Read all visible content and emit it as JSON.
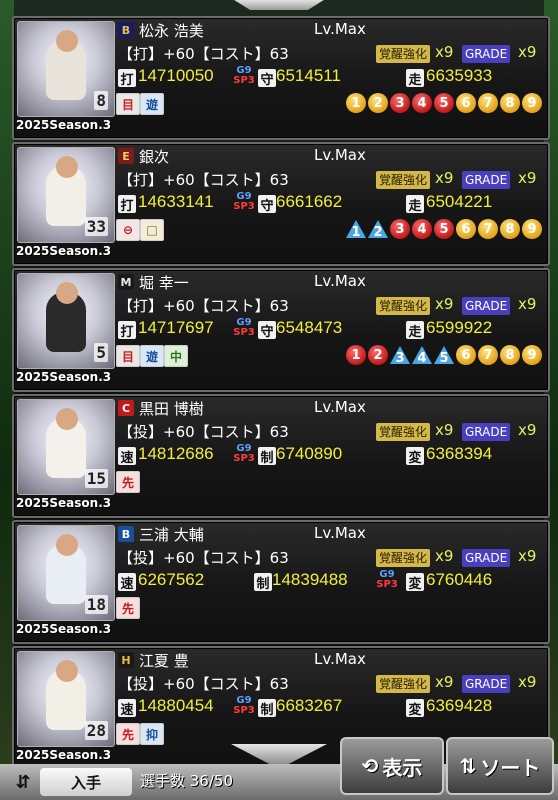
{
  "players": [
    {
      "team_icon": "B",
      "team_color": "#1a1a6a",
      "team_fg": "#e8c23a",
      "name": "松永 浩美",
      "level": "Lv.Max",
      "line2": "【打】+60【コスト】63",
      "awake_label": "覚醒強化",
      "awake_mult": "x9",
      "grade_label": "GRADE",
      "grade_mult": "x9",
      "stats": [
        {
          "label": "打",
          "value": "14710050"
        },
        {
          "label": "守",
          "value": "6514511"
        },
        {
          "label": "走",
          "value": "6635933"
        }
      ],
      "g9": "G9",
      "sp3": "SP3",
      "jersey": "8",
      "uniform_color": "#e8e4dc",
      "season": "2025Season.3",
      "positions": [
        {
          "text": "目",
          "bg": "#e8e8e8",
          "fg": "#d02020"
        },
        {
          "text": "遊",
          "bg": "#d9e6f5",
          "fg": "#1a4fa0"
        }
      ],
      "batting_order": [
        {
          "n": "1",
          "s": "y"
        },
        {
          "n": "2",
          "s": "y"
        },
        {
          "n": "3",
          "s": "r"
        },
        {
          "n": "4",
          "s": "r"
        },
        {
          "n": "5",
          "s": "r"
        },
        {
          "n": "6",
          "s": "y"
        },
        {
          "n": "7",
          "s": "y"
        },
        {
          "n": "8",
          "s": "y"
        },
        {
          "n": "9",
          "s": "y"
        }
      ]
    },
    {
      "team_icon": "E",
      "team_color": "#7a1c1c",
      "team_fg": "#f0d060",
      "name": "銀次",
      "level": "Lv.Max",
      "line2": "【打】+60【コスト】63",
      "awake_label": "覚醒強化",
      "awake_mult": "x9",
      "grade_label": "GRADE",
      "grade_mult": "x9",
      "stats": [
        {
          "label": "打",
          "value": "14633141"
        },
        {
          "label": "守",
          "value": "6661662"
        },
        {
          "label": "走",
          "value": "6504221"
        }
      ],
      "g9": "G9",
      "sp3": "SP3",
      "jersey": "33",
      "uniform_color": "#f2efe8",
      "season": "2025Season.3",
      "positions": [
        {
          "text": "⊖",
          "bg": "#f2e6e6",
          "fg": "#c01a1a"
        },
        {
          "text": "□",
          "bg": "#f2ecd8",
          "fg": "#8a6a10"
        }
      ],
      "batting_order": [
        {
          "n": "1",
          "s": "t"
        },
        {
          "n": "2",
          "s": "t"
        },
        {
          "n": "3",
          "s": "r"
        },
        {
          "n": "4",
          "s": "r"
        },
        {
          "n": "5",
          "s": "r"
        },
        {
          "n": "6",
          "s": "y"
        },
        {
          "n": "7",
          "s": "y"
        },
        {
          "n": "8",
          "s": "y"
        },
        {
          "n": "9",
          "s": "y"
        }
      ]
    },
    {
      "team_icon": "M",
      "team_color": "#1a1a1a",
      "team_fg": "#e8e8e8",
      "name": "堀 幸一",
      "level": "Lv.Max",
      "line2": "【打】+60【コスト】63",
      "awake_label": "覚醒強化",
      "awake_mult": "x9",
      "grade_label": "GRADE",
      "grade_mult": "x9",
      "stats": [
        {
          "label": "打",
          "value": "14717697"
        },
        {
          "label": "守",
          "value": "6548473"
        },
        {
          "label": "走",
          "value": "6599922"
        }
      ],
      "g9": "G9",
      "sp3": "SP3",
      "jersey": "5",
      "uniform_color": "#2a2a2a",
      "season": "2025Season.3",
      "positions": [
        {
          "text": "目",
          "bg": "#e8e8e8",
          "fg": "#d02020"
        },
        {
          "text": "遊",
          "bg": "#d9e6f5",
          "fg": "#1a4fa0"
        },
        {
          "text": "中",
          "bg": "#dff0da",
          "fg": "#2a7a1a"
        }
      ],
      "batting_order": [
        {
          "n": "1",
          "s": "r"
        },
        {
          "n": "2",
          "s": "r"
        },
        {
          "n": "3",
          "s": "t"
        },
        {
          "n": "4",
          "s": "t"
        },
        {
          "n": "5",
          "s": "t"
        },
        {
          "n": "6",
          "s": "y"
        },
        {
          "n": "7",
          "s": "y"
        },
        {
          "n": "8",
          "s": "y"
        },
        {
          "n": "9",
          "s": "y"
        }
      ]
    },
    {
      "team_icon": "C",
      "team_color": "#c01a1a",
      "team_fg": "#ffffff",
      "name": "黒田 博樹",
      "level": "Lv.Max",
      "line2": "【投】+60【コスト】63",
      "awake_label": "覚醒強化",
      "awake_mult": "x9",
      "grade_label": "GRADE",
      "grade_mult": "x9",
      "stats": [
        {
          "label": "速",
          "value": "14812686"
        },
        {
          "label": "制",
          "value": "6740890"
        },
        {
          "label": "変",
          "value": "6368394"
        }
      ],
      "g9": "G9",
      "sp3": "SP3",
      "jersey": "15",
      "uniform_color": "#f4f1ec",
      "season": "2025Season.3",
      "positions": [
        {
          "text": "先",
          "bg": "#f4dede",
          "fg": "#c01a1a"
        }
      ],
      "batting_order": []
    },
    {
      "team_icon": "B",
      "team_color": "#1a4fa0",
      "team_fg": "#ffffff",
      "name": "三浦 大輔",
      "level": "Lv.Max",
      "line2": "【投】+60【コスト】63",
      "awake_label": "覚醒強化",
      "awake_mult": "x9",
      "grade_label": "GRADE",
      "grade_mult": "x9",
      "stats": [
        {
          "label": "速",
          "value": "6267562"
        },
        {
          "label": "制",
          "value": "14839488"
        },
        {
          "label": "変",
          "value": "6760446"
        }
      ],
      "g9": "G9",
      "sp3": "SP3",
      "jersey": "18",
      "uniform_color": "#e9eef5",
      "season": "2025Season.3",
      "positions": [
        {
          "text": "先",
          "bg": "#f4dede",
          "fg": "#c01a1a"
        }
      ],
      "batting_order": []
    },
    {
      "team_icon": "H",
      "team_color": "#1a1a1a",
      "team_fg": "#e8c23a",
      "name": "江夏 豊",
      "level": "Lv.Max",
      "line2": "【投】+60【コスト】63",
      "awake_label": "覚醒強化",
      "awake_mult": "x9",
      "grade_label": "GRADE",
      "grade_mult": "x9",
      "stats": [
        {
          "label": "速",
          "value": "14880454"
        },
        {
          "label": "制",
          "value": "6683267"
        },
        {
          "label": "変",
          "value": "6369428"
        }
      ],
      "g9": "G9",
      "sp3": "SP3",
      "jersey": "28",
      "uniform_color": "#f2efe6",
      "season": "2025Season.3",
      "positions": [
        {
          "text": "先",
          "bg": "#f4dede",
          "fg": "#c01a1a"
        },
        {
          "text": "抑",
          "bg": "#d9e6f5",
          "fg": "#1a4fa0"
        }
      ],
      "batting_order": []
    }
  ],
  "bottom": {
    "filter_icon": "filter-icon",
    "sort_tab_label": "入手",
    "count_label": "選手数 36/50",
    "display_button": "表示",
    "sort_button": "ソート"
  }
}
